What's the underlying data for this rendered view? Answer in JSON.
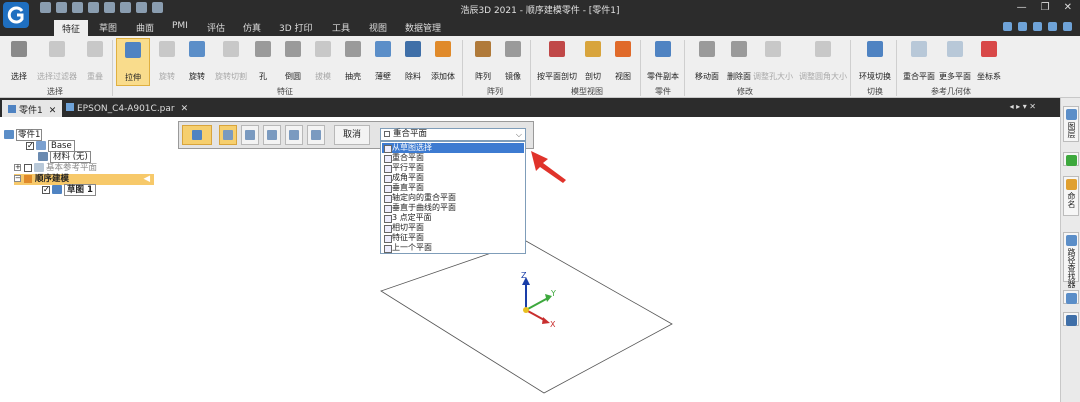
{
  "window": {
    "title": "浩辰3D 2021 - 顺序建模零件 - [零件1]"
  },
  "menu_tabs": [
    {
      "label": "特征",
      "active": true
    },
    {
      "label": "草图"
    },
    {
      "label": "曲面"
    },
    {
      "label": "PMI"
    },
    {
      "label": "评估"
    },
    {
      "label": "仿真"
    },
    {
      "label": "3D 打印"
    },
    {
      "label": "工具"
    },
    {
      "label": "视图"
    },
    {
      "label": "数据管理"
    }
  ],
  "ribbon": {
    "buttons": [
      "选择",
      "选择过滤器",
      "重叠",
      "拉伸",
      "旋转",
      "旋转",
      "旋转切割",
      "孔",
      "倒圆",
      "拔模",
      "抽壳",
      "薄壁",
      "除料",
      "添加体",
      "阵列",
      "镜像",
      "按平面剖切",
      "剖切",
      "视图",
      "零件副本",
      "移动面",
      "删除面",
      "调整孔大小",
      "调整圆角大小",
      "环境切换",
      "重合平面",
      "更多平面",
      "坐标系"
    ],
    "groups": [
      "选择",
      "特征",
      "阵列",
      "模型视图",
      "零件",
      "修改",
      "切换",
      "参考几何体"
    ]
  },
  "doc_tabs": [
    {
      "label": "零件1",
      "active": true
    },
    {
      "label": "EPSON_C4-A901C.par",
      "active": false
    }
  ],
  "tree": {
    "root": "零件1",
    "items": [
      "Base",
      "材料 (无)",
      "基本参考平面",
      "顺序建模",
      "草图 1"
    ]
  },
  "command_bar": {
    "cancel_label": "取消"
  },
  "plane_dropdown": {
    "selected": "重合平面",
    "options": [
      "从草图选择",
      "重合平面",
      "平行平面",
      "成角平面",
      "垂直平面",
      "轴定向的重合平面",
      "垂直于曲线的平面",
      "3 点定平面",
      "相切平面",
      "特征平面",
      "上一个平面"
    ],
    "highlighted_index": 0
  },
  "right_panel": {
    "tabs": [
      "图层",
      "命名",
      "路径查找器"
    ]
  },
  "axes": {
    "x": "X",
    "y": "Y",
    "z": "Z"
  },
  "colors": {
    "accent": "#f6cf6e",
    "highlight": "#3d7bd1",
    "arrow": "#e0332b"
  }
}
